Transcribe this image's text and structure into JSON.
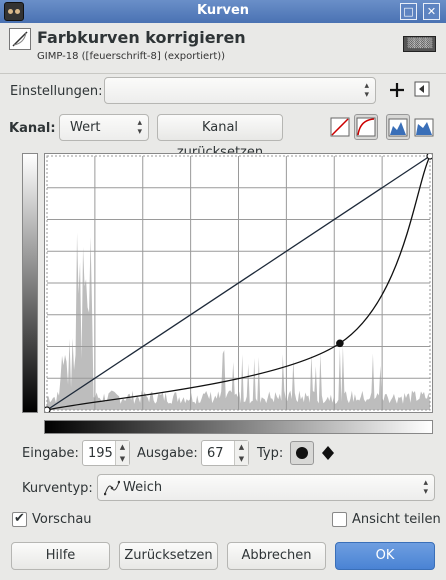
{
  "window": {
    "title": "Kurven"
  },
  "header": {
    "title": "Farbkurven korrigieren",
    "subtitle": "GIMP-18 ([feuerschrift-8] (exportiert))"
  },
  "settings": {
    "label": "Einstellungen:",
    "value": ""
  },
  "channel": {
    "label": "Kanal:",
    "value": "Wert",
    "reset_label": "Kanal zurücksetzen"
  },
  "point": {
    "input_label": "Eingabe:",
    "input_value": "195",
    "output_label": "Ausgabe:",
    "output_value": "67",
    "type_label": "Typ:"
  },
  "curve_type": {
    "label": "Kurventyp:",
    "value": "Weich"
  },
  "preview": {
    "label": "Vorschau",
    "checked": true
  },
  "split": {
    "label": "Ansicht teilen",
    "checked": false
  },
  "buttons": {
    "help": "Hilfe",
    "reset": "Zurücksetzen",
    "cancel": "Abbrechen",
    "ok": "OK"
  },
  "curve": {
    "points": [
      [
        0,
        0
      ],
      [
        195,
        67
      ],
      [
        255,
        255
      ]
    ]
  },
  "colors": {
    "accent": "#4a83d4",
    "titlebar": "#5a80bd"
  }
}
